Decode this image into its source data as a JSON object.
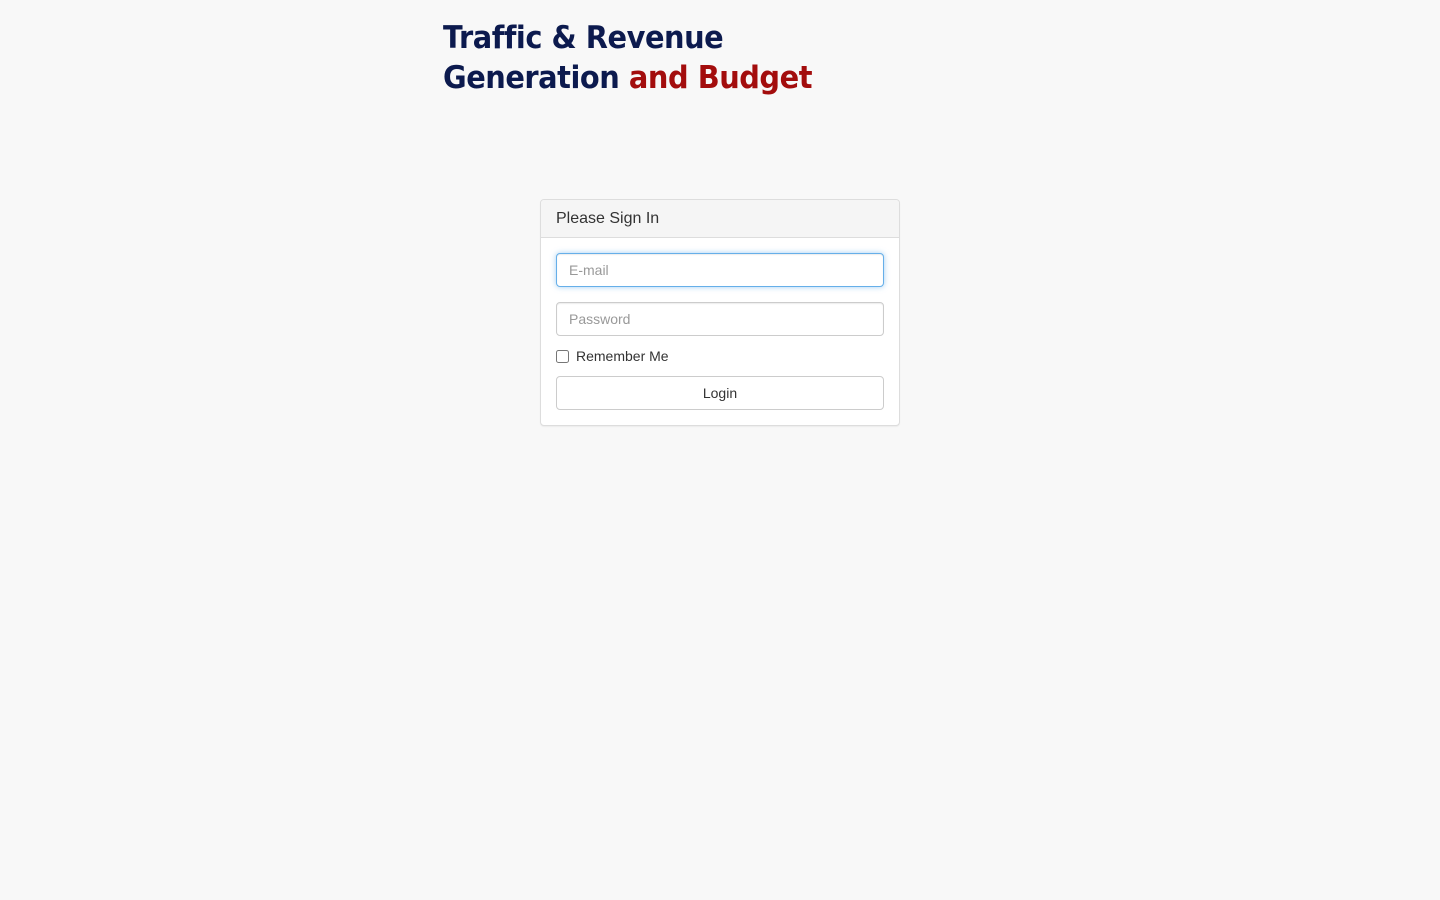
{
  "header": {
    "title_main": "Traffic & Revenue Generation",
    "title_accent": "and Budget",
    "colors": {
      "title_main": "#0c1a4e",
      "title_accent": "#a30d0d"
    }
  },
  "login": {
    "heading": "Please Sign In",
    "email": {
      "value": "",
      "placeholder": "E-mail"
    },
    "password": {
      "value": "",
      "placeholder": "Password"
    },
    "remember_label": "Remember Me",
    "remember_checked": false,
    "submit_label": "Login"
  }
}
